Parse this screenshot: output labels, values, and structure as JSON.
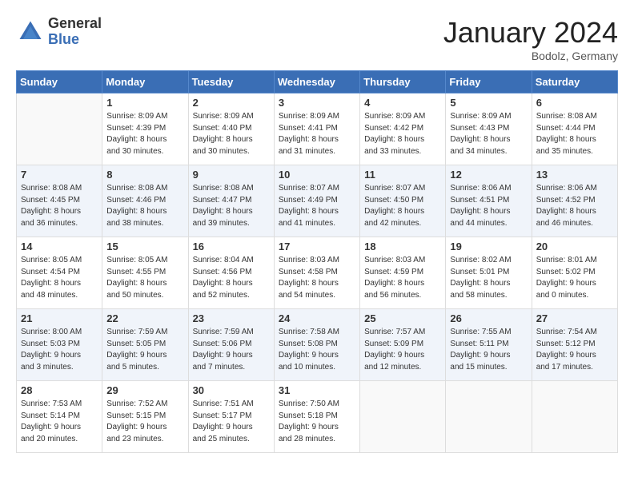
{
  "logo": {
    "general": "General",
    "blue": "Blue"
  },
  "header": {
    "month_year": "January 2024",
    "location": "Bodolz, Germany"
  },
  "weekdays": [
    "Sunday",
    "Monday",
    "Tuesday",
    "Wednesday",
    "Thursday",
    "Friday",
    "Saturday"
  ],
  "weeks": [
    [
      {
        "day": "",
        "info": ""
      },
      {
        "day": "1",
        "info": "Sunrise: 8:09 AM\nSunset: 4:39 PM\nDaylight: 8 hours\nand 30 minutes."
      },
      {
        "day": "2",
        "info": "Sunrise: 8:09 AM\nSunset: 4:40 PM\nDaylight: 8 hours\nand 30 minutes."
      },
      {
        "day": "3",
        "info": "Sunrise: 8:09 AM\nSunset: 4:41 PM\nDaylight: 8 hours\nand 31 minutes."
      },
      {
        "day": "4",
        "info": "Sunrise: 8:09 AM\nSunset: 4:42 PM\nDaylight: 8 hours\nand 33 minutes."
      },
      {
        "day": "5",
        "info": "Sunrise: 8:09 AM\nSunset: 4:43 PM\nDaylight: 8 hours\nand 34 minutes."
      },
      {
        "day": "6",
        "info": "Sunrise: 8:08 AM\nSunset: 4:44 PM\nDaylight: 8 hours\nand 35 minutes."
      }
    ],
    [
      {
        "day": "7",
        "info": "Sunrise: 8:08 AM\nSunset: 4:45 PM\nDaylight: 8 hours\nand 36 minutes."
      },
      {
        "day": "8",
        "info": "Sunrise: 8:08 AM\nSunset: 4:46 PM\nDaylight: 8 hours\nand 38 minutes."
      },
      {
        "day": "9",
        "info": "Sunrise: 8:08 AM\nSunset: 4:47 PM\nDaylight: 8 hours\nand 39 minutes."
      },
      {
        "day": "10",
        "info": "Sunrise: 8:07 AM\nSunset: 4:49 PM\nDaylight: 8 hours\nand 41 minutes."
      },
      {
        "day": "11",
        "info": "Sunrise: 8:07 AM\nSunset: 4:50 PM\nDaylight: 8 hours\nand 42 minutes."
      },
      {
        "day": "12",
        "info": "Sunrise: 8:06 AM\nSunset: 4:51 PM\nDaylight: 8 hours\nand 44 minutes."
      },
      {
        "day": "13",
        "info": "Sunrise: 8:06 AM\nSunset: 4:52 PM\nDaylight: 8 hours\nand 46 minutes."
      }
    ],
    [
      {
        "day": "14",
        "info": "Sunrise: 8:05 AM\nSunset: 4:54 PM\nDaylight: 8 hours\nand 48 minutes."
      },
      {
        "day": "15",
        "info": "Sunrise: 8:05 AM\nSunset: 4:55 PM\nDaylight: 8 hours\nand 50 minutes."
      },
      {
        "day": "16",
        "info": "Sunrise: 8:04 AM\nSunset: 4:56 PM\nDaylight: 8 hours\nand 52 minutes."
      },
      {
        "day": "17",
        "info": "Sunrise: 8:03 AM\nSunset: 4:58 PM\nDaylight: 8 hours\nand 54 minutes."
      },
      {
        "day": "18",
        "info": "Sunrise: 8:03 AM\nSunset: 4:59 PM\nDaylight: 8 hours\nand 56 minutes."
      },
      {
        "day": "19",
        "info": "Sunrise: 8:02 AM\nSunset: 5:01 PM\nDaylight: 8 hours\nand 58 minutes."
      },
      {
        "day": "20",
        "info": "Sunrise: 8:01 AM\nSunset: 5:02 PM\nDaylight: 9 hours\nand 0 minutes."
      }
    ],
    [
      {
        "day": "21",
        "info": "Sunrise: 8:00 AM\nSunset: 5:03 PM\nDaylight: 9 hours\nand 3 minutes."
      },
      {
        "day": "22",
        "info": "Sunrise: 7:59 AM\nSunset: 5:05 PM\nDaylight: 9 hours\nand 5 minutes."
      },
      {
        "day": "23",
        "info": "Sunrise: 7:59 AM\nSunset: 5:06 PM\nDaylight: 9 hours\nand 7 minutes."
      },
      {
        "day": "24",
        "info": "Sunrise: 7:58 AM\nSunset: 5:08 PM\nDaylight: 9 hours\nand 10 minutes."
      },
      {
        "day": "25",
        "info": "Sunrise: 7:57 AM\nSunset: 5:09 PM\nDaylight: 9 hours\nand 12 minutes."
      },
      {
        "day": "26",
        "info": "Sunrise: 7:55 AM\nSunset: 5:11 PM\nDaylight: 9 hours\nand 15 minutes."
      },
      {
        "day": "27",
        "info": "Sunrise: 7:54 AM\nSunset: 5:12 PM\nDaylight: 9 hours\nand 17 minutes."
      }
    ],
    [
      {
        "day": "28",
        "info": "Sunrise: 7:53 AM\nSunset: 5:14 PM\nDaylight: 9 hours\nand 20 minutes."
      },
      {
        "day": "29",
        "info": "Sunrise: 7:52 AM\nSunset: 5:15 PM\nDaylight: 9 hours\nand 23 minutes."
      },
      {
        "day": "30",
        "info": "Sunrise: 7:51 AM\nSunset: 5:17 PM\nDaylight: 9 hours\nand 25 minutes."
      },
      {
        "day": "31",
        "info": "Sunrise: 7:50 AM\nSunset: 5:18 PM\nDaylight: 9 hours\nand 28 minutes."
      },
      {
        "day": "",
        "info": ""
      },
      {
        "day": "",
        "info": ""
      },
      {
        "day": "",
        "info": ""
      }
    ]
  ]
}
